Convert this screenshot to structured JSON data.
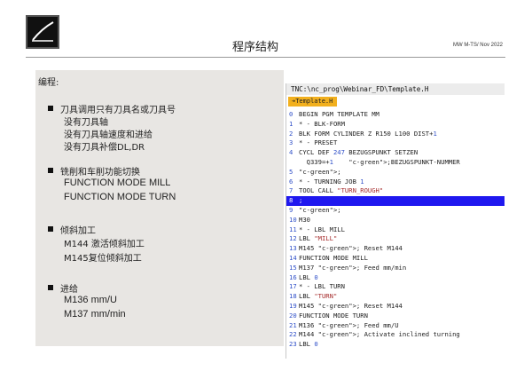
{
  "header": {
    "title": "程序结构",
    "doc_ref": "MW M-TS/ Nov 2022"
  },
  "left": {
    "edit_label": "编程:",
    "sections": [
      {
        "title": "刀具调用只有刀具名或刀具号",
        "lines": [
          "没有刀具轴",
          "没有刀具轴速度和进给",
          "没有刀具补偿DL,DR"
        ]
      },
      {
        "title": "铣削和车削功能切换",
        "lines": [
          "FUNCTION MODE MILL",
          "FUNCTION MODE TURN"
        ]
      },
      {
        "title": "倾斜加工",
        "lines": [
          "M144 激活倾斜加工",
          "M145复位倾斜加工"
        ]
      },
      {
        "title": "进给",
        "lines": [
          "M136  mm/U",
          "M137  mm/min"
        ]
      }
    ]
  },
  "editor": {
    "path": "TNC:\\nc_prog\\Webinar_FD\\Template.H",
    "tab_label": "Template.H",
    "lines": [
      {
        "n": "0",
        "text": "BEGIN PGM TEMPLATE MM"
      },
      {
        "n": "1",
        "text": "* - BLK-FORM"
      },
      {
        "n": "2",
        "text": "BLK FORM CYLINDER Z R150 L100 DIST+1"
      },
      {
        "n": "3",
        "text": "* - PRESET"
      },
      {
        "n": "4",
        "text": "CYCL DEF 247 BEZUGSPUNKT SETZEN"
      },
      {
        "n": "",
        "text": "  Q339=+1    ;BEZUGSPUNKT-NUMMER"
      },
      {
        "n": "5",
        "text": ";"
      },
      {
        "n": "6",
        "text": "* - TURNING JOB 1"
      },
      {
        "n": "7",
        "text": "TOOL CALL \"TURN_ROUGH\""
      },
      {
        "n": "8",
        "text": ";"
      },
      {
        "n": "9",
        "text": ";"
      },
      {
        "n": "10",
        "text": "M30"
      },
      {
        "n": "11",
        "text": "* - LBL MILL"
      },
      {
        "n": "12",
        "text": "LBL \"MILL\""
      },
      {
        "n": "13",
        "text": "M145 ; Reset M144"
      },
      {
        "n": "14",
        "text": "FUNCTION MODE MILL"
      },
      {
        "n": "15",
        "text": "M137 ; Feed mm/min"
      },
      {
        "n": "16",
        "text": "LBL 0"
      },
      {
        "n": "17",
        "text": "* - LBL TURN"
      },
      {
        "n": "18",
        "text": "LBL \"TURN\""
      },
      {
        "n": "19",
        "text": "M145 ; Reset M144"
      },
      {
        "n": "20",
        "text": "FUNCTION MODE TURN"
      },
      {
        "n": "21",
        "text": "M136 ; Feed mm/U"
      },
      {
        "n": "22",
        "text": "M144 ; Activate inclined turning"
      },
      {
        "n": "23",
        "text": "LBL 0"
      }
    ],
    "selected_line": "8"
  },
  "colors": {
    "selection": "#1f18ef",
    "tab": "#f2b01e",
    "panel": "#e8e6e3"
  }
}
